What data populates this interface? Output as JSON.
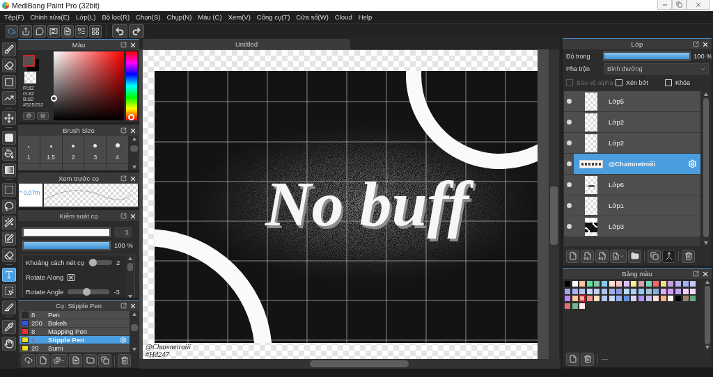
{
  "window": {
    "title": "MediBang Paint Pro (32bit)"
  },
  "menu": [
    "Tệp(F)",
    "Chỉnh sửa(E)",
    "Lớp(L)",
    "Bộ lọc(R)",
    "Chọn(S)",
    "Chụp(N)",
    "Màu (C)",
    "Xem(V)",
    "Công cụ(T)",
    "Cửa sổ(W)",
    "Cloud",
    "Help"
  ],
  "tool_groups": [
    [
      {
        "kind": "brush",
        "selected": false
      },
      {
        "kind": "eraser",
        "selected": false
      },
      {
        "kind": "shape",
        "selected": false
      },
      {
        "kind": "polyline",
        "selected": false
      }
    ],
    [
      {
        "kind": "move",
        "selected": false
      }
    ],
    [
      {
        "kind": "fill",
        "selected": false
      },
      {
        "kind": "bucket",
        "selected": false
      },
      {
        "kind": "gradient",
        "selected": false
      }
    ],
    [
      {
        "kind": "select",
        "selected": false
      },
      {
        "kind": "lasso",
        "selected": false
      },
      {
        "kind": "wand",
        "selected": false
      },
      {
        "kind": "select-pen",
        "selected": false
      },
      {
        "kind": "select-eraser",
        "selected": false
      }
    ],
    [
      {
        "kind": "text",
        "selected": true
      },
      {
        "kind": "operation",
        "selected": false
      },
      {
        "kind": "divide",
        "selected": false
      }
    ],
    [
      {
        "kind": "eyedropper",
        "selected": false
      },
      {
        "kind": "hand",
        "selected": false
      }
    ]
  ],
  "color_panel": {
    "title": "Màu",
    "readout": [
      "R:82",
      "G:82",
      "B:82",
      "#525252"
    ]
  },
  "brush_size": {
    "title": "Brush Size",
    "sizes": [
      "1",
      "1.5",
      "2",
      "3",
      "4"
    ]
  },
  "brush_preview": {
    "title": "Xem trước cọ",
    "size_label": "* 0.07m"
  },
  "brush_control": {
    "title": "Kiểm soát cọ",
    "size": {
      "level": 1,
      "reading": "1"
    },
    "opacity": {
      "level": 1,
      "reading": "100 %"
    },
    "settings": [
      {
        "kind": "slider",
        "label": "Khoảng cách nét cọ",
        "level": 0.05,
        "reading": "2"
      },
      {
        "kind": "checkbox",
        "label": "Rotate Along",
        "checked": true
      },
      {
        "kind": "slider",
        "label": "Rotate Angle",
        "level": 0.45,
        "reading": "-3"
      }
    ]
  },
  "brush_list": {
    "title": "Cọ: Stipple Pen",
    "brushes": [
      {
        "size": "8",
        "name": "Pen",
        "color": "#2a2a2a",
        "selected": false
      },
      {
        "size": "200",
        "name": "Bokeh",
        "color": "#3355ee",
        "selected": false
      },
      {
        "size": "8",
        "name": "Mapping Pen",
        "color": "#ee3333",
        "selected": false
      },
      {
        "size": "1",
        "name": "Stipple Pen",
        "color": "#eedd22",
        "selected": true
      },
      {
        "size": "20",
        "name": "Sumi",
        "color": "#eedd22",
        "selected": false
      }
    ]
  },
  "document": {
    "tab": "Untitled",
    "lettering": "No buff",
    "signature": [
      "@Chamnetroiii",
      "#Hd247"
    ]
  },
  "layers_panel": {
    "title": "Lớp",
    "opacity_label": "Độ trong",
    "opacity": {
      "level": 1,
      "reading": "100 %"
    },
    "blend_label": "Pha trộn",
    "blend_value": "Bình thường",
    "options": [
      {
        "label": "Bảo vệ alpha",
        "checked": false,
        "disabled": true
      },
      {
        "label": "Xén bớt",
        "checked": false,
        "disabled": false
      },
      {
        "label": "Khóa",
        "checked": false,
        "disabled": false
      }
    ],
    "layers": [
      {
        "name": "Lớp5",
        "thumbnail": {
          "kind": "empty"
        },
        "visible": true,
        "selected": false
      },
      {
        "name": "Lớp2",
        "thumbnail": {
          "kind": "empty"
        },
        "visible": true,
        "selected": false
      },
      {
        "name": "Lớp2",
        "thumbnail": {
          "kind": "empty"
        },
        "visible": true,
        "selected": false
      },
      {
        "name": "@Chamnetroiii",
        "thumbnail": {
          "kind": "text"
        },
        "visible": true,
        "selected": true
      },
      {
        "name": "Lớp6",
        "thumbnail": {
          "kind": "stroke"
        },
        "visible": true,
        "selected": false
      },
      {
        "name": "Lớp1",
        "thumbnail": {
          "kind": "empty"
        },
        "visible": true,
        "selected": false
      },
      {
        "name": "Lớp3",
        "thumbnail": {
          "kind": "artwork"
        },
        "visible": true,
        "selected": false
      }
    ]
  },
  "palette": {
    "title": "Bảng màu",
    "swatches": [
      {
        "color": "#000000",
        "selected": false
      },
      {
        "color": "#ffffff",
        "selected": false
      },
      {
        "color": "#ffc0a0",
        "selected": false
      },
      {
        "color": "#60e0a0",
        "selected": false
      },
      {
        "color": "#80c8a0",
        "selected": false
      },
      {
        "color": "#88c8f0",
        "selected": false
      },
      {
        "color": "#ffe0d0",
        "selected": false
      },
      {
        "color": "#ffc0c8",
        "selected": false
      },
      {
        "color": "#d8c0f8",
        "selected": false
      },
      {
        "color": "#f8f090",
        "selected": false
      },
      {
        "color": "#d8a0a8",
        "selected": false
      },
      {
        "color": "#80d0b8",
        "selected": false
      },
      {
        "color": "#f06868",
        "selected": false
      },
      {
        "color": "#f0e080",
        "selected": false
      },
      {
        "color": "#c0a0e0",
        "selected": false
      },
      {
        "color": "#b8b0f8",
        "selected": false
      },
      {
        "color": "#a8b0f8",
        "selected": false
      },
      {
        "color": "#c0c8f8",
        "selected": false
      },
      {
        "color": "#a0a8e8",
        "selected": false
      },
      {
        "color": "#a8b0f8",
        "selected": false
      },
      {
        "color": "#b0c4f8",
        "selected": false
      },
      {
        "color": "#c8d8f8",
        "selected": false
      },
      {
        "color": "#c0d0f8",
        "selected": false
      },
      {
        "color": "#b0c0f0",
        "selected": false
      },
      {
        "color": "#a0b0e8",
        "selected": false
      },
      {
        "color": "#9098e0",
        "selected": false
      },
      {
        "color": "#b8d8f8",
        "selected": false
      },
      {
        "color": "#a8d0f8",
        "selected": false
      },
      {
        "color": "#90c8f0",
        "selected": false
      },
      {
        "color": "#a0c0e0",
        "selected": false
      },
      {
        "color": "#80b0e0",
        "selected": false
      },
      {
        "color": "#e0a8f8",
        "selected": false
      },
      {
        "color": "#d0a0f8",
        "selected": false
      },
      {
        "color": "#c0a0f8",
        "selected": false
      },
      {
        "color": "#f0d0f8",
        "selected": false
      },
      {
        "color": "#f0d8f8",
        "selected": false
      },
      {
        "color": "#c080f8",
        "selected": false
      },
      {
        "color": "#ffc8a0",
        "selected": false
      },
      {
        "color": "#ffb0a0",
        "selected": true
      },
      {
        "color": "#ff9090",
        "selected": false
      },
      {
        "color": "#ffe0c0",
        "selected": false
      },
      {
        "color": "#b0c8f8",
        "selected": false
      },
      {
        "color": "#c8d8f8",
        "selected": false
      },
      {
        "color": "#90b0f0",
        "selected": false
      },
      {
        "color": "#6090e0",
        "selected": false
      },
      {
        "color": "#e0d0f8",
        "selected": false
      },
      {
        "color": "#b090f8",
        "selected": false
      },
      {
        "color": "#c8b8f0",
        "selected": false
      },
      {
        "color": "#ffe0d8",
        "selected": false
      },
      {
        "color": "#ffb080",
        "selected": false
      },
      {
        "color": "#fff8f0",
        "selected": false
      },
      {
        "color": "#000000",
        "selected": false
      },
      {
        "color": "#a08070",
        "selected": false
      },
      {
        "color": "#60a880",
        "selected": false
      },
      {
        "color": "#e07070",
        "selected": false
      },
      {
        "color": "#70b890",
        "selected": false
      },
      {
        "color": "#fff0f0",
        "selected": false
      }
    ],
    "status": "---"
  }
}
